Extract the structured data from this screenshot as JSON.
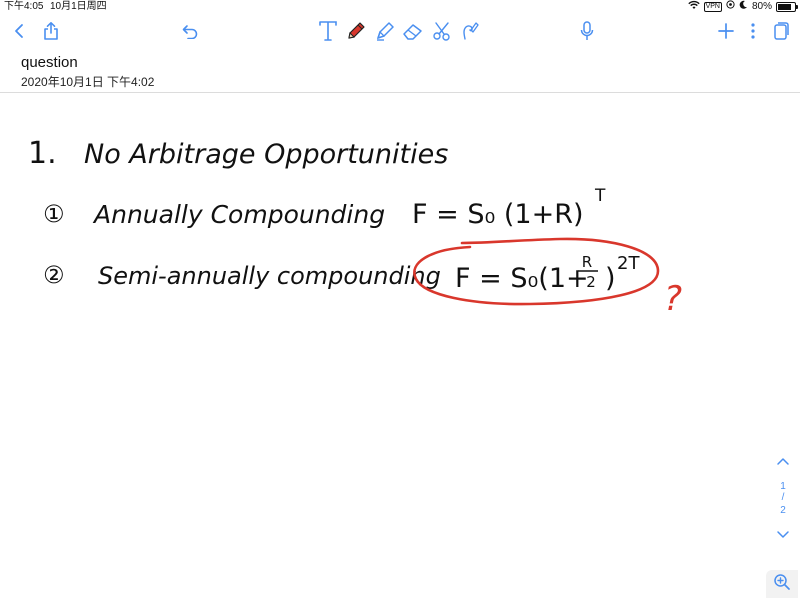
{
  "status_bar": {
    "time": "下午4:05",
    "date": "10月1日周四",
    "vpn": "VPN",
    "battery": "80%",
    "battery_level": 0.8
  },
  "toolbar": {
    "left_icons": [
      "back-icon",
      "share-icon",
      "undo-icon"
    ],
    "tools": [
      "text-tool-icon",
      "pen-tool-icon",
      "highlighter-tool-icon",
      "eraser-tool-icon",
      "lasso-tool-icon",
      "shape-tool-icon"
    ],
    "right_icons": [
      "microphone-icon",
      "add-icon",
      "more-icon",
      "pages-icon"
    ],
    "accent_color": "#4a8ff0",
    "active_pen_color": "#d9372c"
  },
  "document": {
    "title": "question",
    "date": "2020年10月1日 下午4:02"
  },
  "note": {
    "heading_number": "1.",
    "heading": "No Arbitrage Opportunities",
    "item1_marker": "①",
    "item1_text": "Annually Compounding",
    "item1_formula": "F = S₀ (1+R)",
    "item1_exp": "T",
    "item2_marker": "②",
    "item2_text": "Semi-annually compounding",
    "item2_formula_lhs": "F = S₀(1+",
    "item2_frac_num": "R",
    "item2_frac_den": "2",
    "item2_formula_close": ")",
    "item2_exp": "2T",
    "annotation": "?",
    "annotation_color": "#d9372c",
    "ink_color": "#111111"
  },
  "page_nav": {
    "current": "1",
    "separator": "/",
    "total": "2"
  }
}
